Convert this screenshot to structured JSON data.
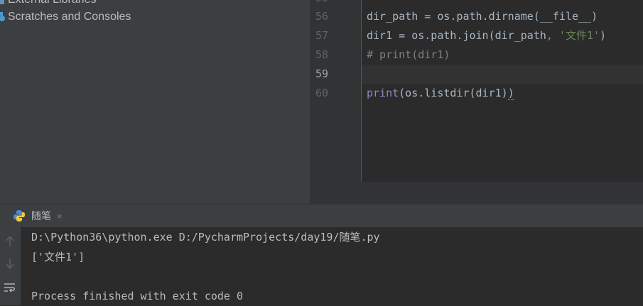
{
  "project_tree": {
    "items": [
      {
        "label": "External Libraries",
        "icon": "library-icon"
      },
      {
        "label": "Scratches and Consoles",
        "icon": "scratches-icon"
      }
    ]
  },
  "editor": {
    "lines": [
      {
        "num": "56",
        "code": "dir_path = os.path.dirname(__file__)"
      },
      {
        "num": "57",
        "code_a": "dir1 = os.path.join(dir_path",
        "comma": ",",
        "code_str": " '文件1'",
        "code_b": ")"
      },
      {
        "num": "58",
        "comment": "# print(dir1)"
      },
      {
        "num": "59",
        "code": ""
      },
      {
        "num": "60",
        "builtin": "print",
        "code": "(os.listdir(dir1)",
        "squiggle": ")"
      }
    ],
    "current_line": "59"
  },
  "run": {
    "tab_label": "随笔",
    "close_glyph": "×",
    "console": [
      "D:\\Python36\\python.exe D:/PycharmProjects/day19/随笔.py",
      "['文件1']",
      "",
      "Process finished with exit code 0"
    ]
  },
  "colors": {
    "panel_bg": "#3c3f41",
    "editor_bg": "#2b2b2b",
    "string": "#6a8759",
    "comment": "#808080",
    "builtin": "#8888c6",
    "keyword": "#cc7832"
  }
}
